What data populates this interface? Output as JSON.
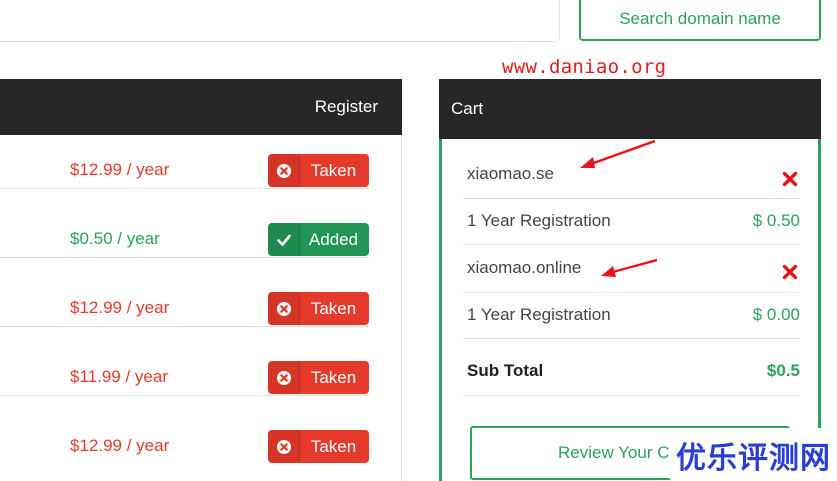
{
  "search": {
    "button_label": "Search domain name"
  },
  "watermark": {
    "url": "www.daniao.org",
    "site_name": "优乐评测网"
  },
  "table": {
    "register_header": "Register",
    "rows": [
      {
        "price": "$12.99 / year",
        "status": "Taken",
        "state": "taken"
      },
      {
        "price": "$0.50 / year",
        "status": "Added",
        "state": "added"
      },
      {
        "price": "$12.99 / year",
        "status": "Taken",
        "state": "taken"
      },
      {
        "price": "$11.99 / year",
        "status": "Taken",
        "state": "taken"
      },
      {
        "price": "$12.99 / year",
        "status": "Taken",
        "state": "taken"
      }
    ]
  },
  "cart": {
    "title": "Cart",
    "items": [
      {
        "domain": "xiaomao.se",
        "term": "1 Year Registration",
        "price": "$ 0.50"
      },
      {
        "domain": "xiaomao.online",
        "term": "1 Year Registration",
        "price": "$ 0.00"
      }
    ],
    "subtotal_label": "Sub Total",
    "subtotal_value": "$0.5",
    "review_label": "Review Your Cart"
  },
  "colors": {
    "green": "#2ea25b",
    "red": "#e53a2b",
    "header_bg": "#272727",
    "watermark_blue": "#2a3ed6"
  },
  "icons": {
    "taken": "circle-x-icon",
    "added": "checkmark-icon",
    "remove": "red-x-icon",
    "annotation": "red-arrow"
  }
}
